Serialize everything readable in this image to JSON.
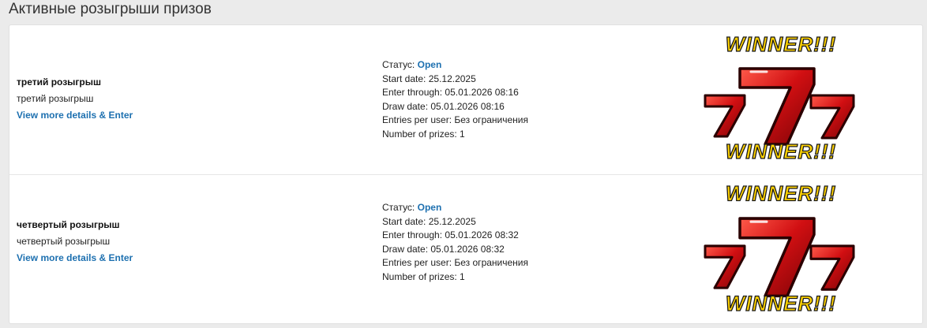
{
  "page": {
    "title": "Активные розыгрыши призов"
  },
  "labels": {
    "status": "Статус:",
    "start_date": "Start date:",
    "enter_through": "Enter through:",
    "draw_date": "Draw date:",
    "entries_per_user": "Entries per user:",
    "number_of_prizes": "Number of prizes:"
  },
  "giveaways": [
    {
      "name": "третий розыгрыш",
      "description": "третий розыгрыш",
      "link_text": "View more details & Enter",
      "status": "Open",
      "start_date": "25.12.2025",
      "enter_through": "05.01.2026 08:16",
      "draw_date": "05.01.2026 08:16",
      "entries_per_user": "Без ограничения",
      "number_of_prizes": "1",
      "image_text_top": "WINNER!!!",
      "image_text_bottom": "WINNER!!!"
    },
    {
      "name": "четвертый розыгрыш",
      "description": "четвертый розыгрыш",
      "link_text": "View more details & Enter",
      "status": "Open",
      "start_date": "25.12.2025",
      "enter_through": "05.01.2026 08:32",
      "draw_date": "05.01.2026 08:32",
      "entries_per_user": "Без ограничения",
      "number_of_prizes": "1",
      "image_text_top": "WINNER!!!",
      "image_text_bottom": "WINNER!!!"
    }
  ],
  "colors": {
    "link": "#1d70b0",
    "seven_red": "#d10f12",
    "winner_yellow": "#ffd200"
  }
}
